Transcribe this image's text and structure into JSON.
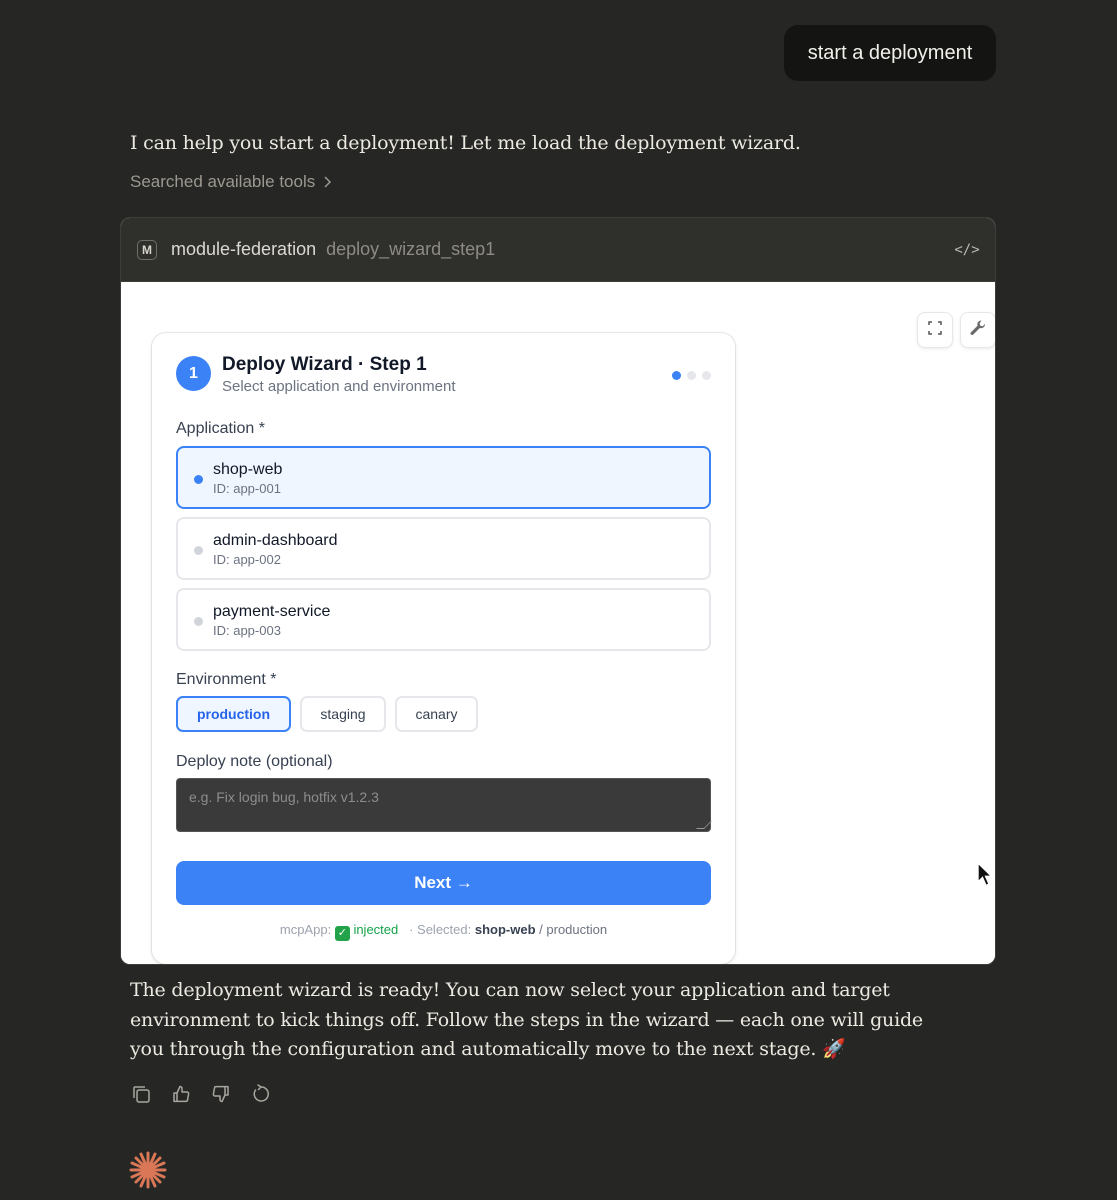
{
  "user_message": "start a deployment",
  "assistant": {
    "intro": "I can help you start a deployment! Let me load the deployment wizard.",
    "searched_tools": "Searched available tools",
    "outro": "The deployment wizard is ready! You can now select your application and target environment to kick things off. Follow the steps in the wizard — each one will guide you through the configuration and automatically move to the next stage. 🚀"
  },
  "tool_card": {
    "badge": "M",
    "server": "module-federation",
    "tool": "deploy_wizard_step1",
    "code_icon": "</>"
  },
  "wizard": {
    "step_number": "1",
    "title": "Deploy Wizard · Step 1",
    "subtitle": "Select application and environment",
    "step_dots": {
      "total": 3,
      "active": 1
    },
    "application_label": "Application *",
    "applications": [
      {
        "name": "shop-web",
        "id": "ID: app-001",
        "selected": true
      },
      {
        "name": "admin-dashboard",
        "id": "ID: app-002",
        "selected": false
      },
      {
        "name": "payment-service",
        "id": "ID: app-003",
        "selected": false
      }
    ],
    "environment_label": "Environment *",
    "environments": [
      {
        "label": "production",
        "selected": true
      },
      {
        "label": "staging",
        "selected": false
      },
      {
        "label": "canary",
        "selected": false
      }
    ],
    "note_label": "Deploy note (optional)",
    "note_placeholder": "e.g. Fix login bug, hotfix v1.2.3",
    "next_button": "Next →",
    "footer": {
      "prefix": "mcpApp:",
      "check": "✓",
      "status": "injected",
      "selected_prefix": "· Selected:",
      "selected_app": "shop-web",
      "selected_env": "/ production"
    }
  },
  "colors": {
    "accent": "#3b82f6",
    "background": "#262624",
    "success": "#16a34a",
    "spark": "#d97757"
  },
  "icons": [
    "fullscreen-icon",
    "wrench-icon",
    "copy-icon",
    "thumbs-up-icon",
    "thumbs-down-icon",
    "retry-icon",
    "claude-spark-icon",
    "cursor-icon"
  ]
}
